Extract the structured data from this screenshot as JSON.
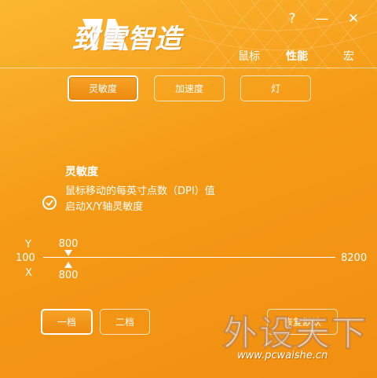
{
  "app": {
    "logo_text": "致雪智造"
  },
  "window_controls": {
    "help": "?",
    "minimize": "—",
    "close": "✕"
  },
  "nav": [
    {
      "label": "鼠标"
    },
    {
      "label": "性能"
    },
    {
      "label": "宏"
    }
  ],
  "tabs": [
    {
      "label": "灵敏度"
    },
    {
      "label": "加速度"
    },
    {
      "label": "灯"
    }
  ],
  "sensitivity": {
    "title": "灵敏度",
    "description": "鼠标移动的每英寸点数（DPI）值",
    "xy_toggle_label": "启动X/Y轴灵敏度",
    "xy_toggle_checked": true
  },
  "slider": {
    "y_label": "Y",
    "x_label": "X",
    "min_label": "100",
    "max_label": "8200",
    "min": 100,
    "max": 8200,
    "y_value": 800,
    "x_value": 800,
    "y_value_text": "800",
    "x_value_text": "800"
  },
  "levels": [
    {
      "label": "一档"
    },
    {
      "label": "二档"
    }
  ],
  "reset_button": {
    "label": "恢复默认"
  },
  "watermark": {
    "text": "外设天下",
    "url": "www.pcwaishe.cn"
  },
  "colors": {
    "background": "#f59a16",
    "foreground": "#ffffff"
  }
}
